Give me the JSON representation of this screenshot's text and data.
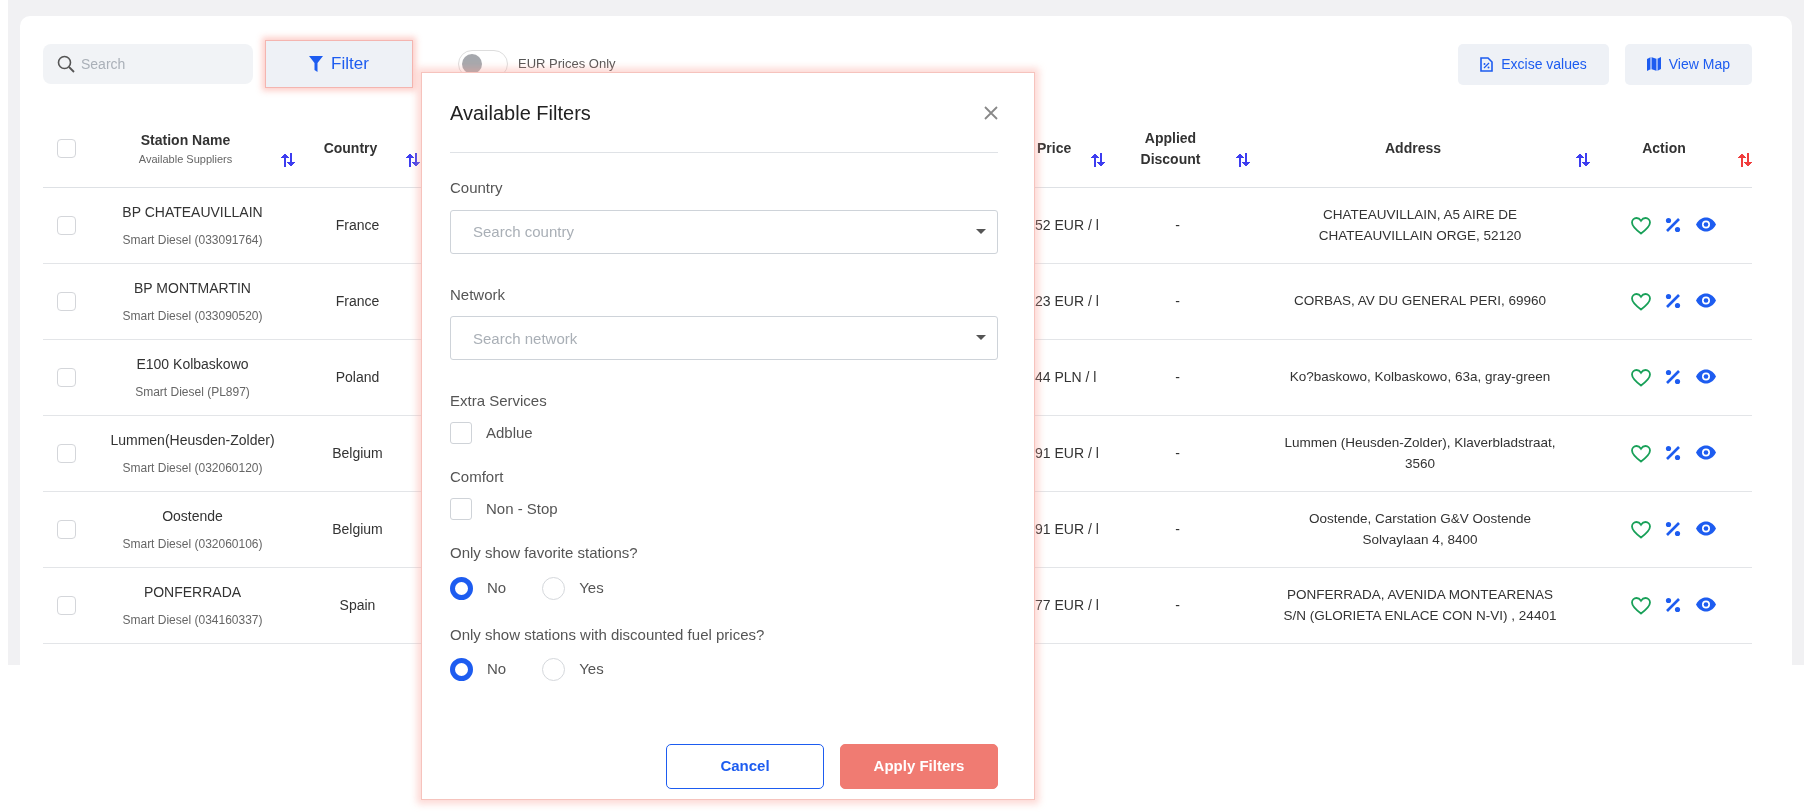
{
  "toolbar": {
    "search": {
      "placeholder": "Search"
    },
    "filter_button": "Filter",
    "toggle": {
      "label": "EUR Prices Only",
      "on": false
    },
    "buttons": [
      {
        "kind": "excise",
        "label": "Excise values"
      },
      {
        "kind": "map",
        "label": "View Map"
      }
    ]
  },
  "table": {
    "select_all": {
      "checked": false
    },
    "columns": [
      {
        "kind": "station",
        "label": "Station Name",
        "sublabel": "Available Suppliers",
        "color": "#3d3df0"
      },
      {
        "kind": "country",
        "label": "Country",
        "color": "#3d3df0"
      },
      {
        "kind": "price",
        "label": "Price",
        "color": "#3d3df0"
      },
      {
        "kind": "discount",
        "label": "Applied Discount",
        "color": "#3d3df0"
      },
      {
        "kind": "address",
        "label": "Address",
        "color": "#3d3df0"
      },
      {
        "kind": "action",
        "label": "Action",
        "color": "#f03d3d"
      }
    ],
    "rows": [
      {
        "checked": false,
        "station": "BP CHATEAUVILLAIN",
        "supplier": "Smart Diesel (033091764)",
        "country": "France",
        "price": "52 EUR / l",
        "discount": "-",
        "address": "CHATEAUVILLAIN, A5 AIRE DE CHATEAUVILLAIN ORGE, 52120"
      },
      {
        "checked": false,
        "station": "BP MONTMARTIN",
        "supplier": "Smart Diesel (033090520)",
        "country": "France",
        "price": "23 EUR / l",
        "discount": "-",
        "address": "CORBAS, AV DU GENERAL PERI, 69960"
      },
      {
        "checked": false,
        "station": "E100 Kolbaskowo",
        "supplier": "Smart Diesel (PL897)",
        "country": "Poland",
        "price": "44 PLN / l",
        "discount": "-",
        "address": "Ko?baskowo, Kolbaskowo, 63a, gray-green"
      },
      {
        "checked": false,
        "station": "Lummen(Heusden-Zolder)",
        "supplier": "Smart Diesel (032060120)",
        "country": "Belgium",
        "price": "91 EUR / l",
        "discount": "-",
        "address": "Lummen (Heusden-Zolder), Klaverbladstraat, 3560"
      },
      {
        "checked": false,
        "station": "Oostende",
        "supplier": "Smart Diesel (032060106)",
        "country": "Belgium",
        "price": "91 EUR / l",
        "discount": "-",
        "address": "Oostende, Carstation G&V Oostende Solvaylaan 4, 8400"
      },
      {
        "checked": false,
        "station": "PONFERRADA",
        "supplier": "Smart Diesel (034160337)",
        "country": "Spain",
        "price": "77 EUR / l",
        "discount": "-",
        "address": "PONFERRADA, AVENIDA MONTEARENAS S/N (GLORIETA ENLACE CON N-VI) , 24401"
      }
    ]
  },
  "modal": {
    "title": "Available Filters",
    "sections": [
      {
        "kind": "select",
        "label": "Country",
        "placeholder": "Search country"
      },
      {
        "kind": "select",
        "label": "Network",
        "placeholder": "Search network"
      },
      {
        "kind": "checkbox",
        "label": "Extra Services",
        "options": [
          {
            "label": "Adblue",
            "checked": false
          }
        ]
      },
      {
        "kind": "checkbox",
        "label": "Comfort",
        "options": [
          {
            "label": "Non - Stop",
            "checked": false
          }
        ]
      },
      {
        "kind": "radio",
        "label": "Only show favorite stations?",
        "options": [
          {
            "label": "No",
            "selected": true
          },
          {
            "label": "Yes",
            "selected": false
          }
        ]
      },
      {
        "kind": "radio",
        "label": "Only show stations with discounted fuel prices?",
        "options": [
          {
            "label": "No",
            "selected": true
          },
          {
            "label": "Yes",
            "selected": false
          }
        ]
      }
    ],
    "buttons": [
      {
        "kind": "cancel",
        "label": "Cancel"
      },
      {
        "kind": "apply",
        "label": "Apply Filters"
      }
    ]
  }
}
